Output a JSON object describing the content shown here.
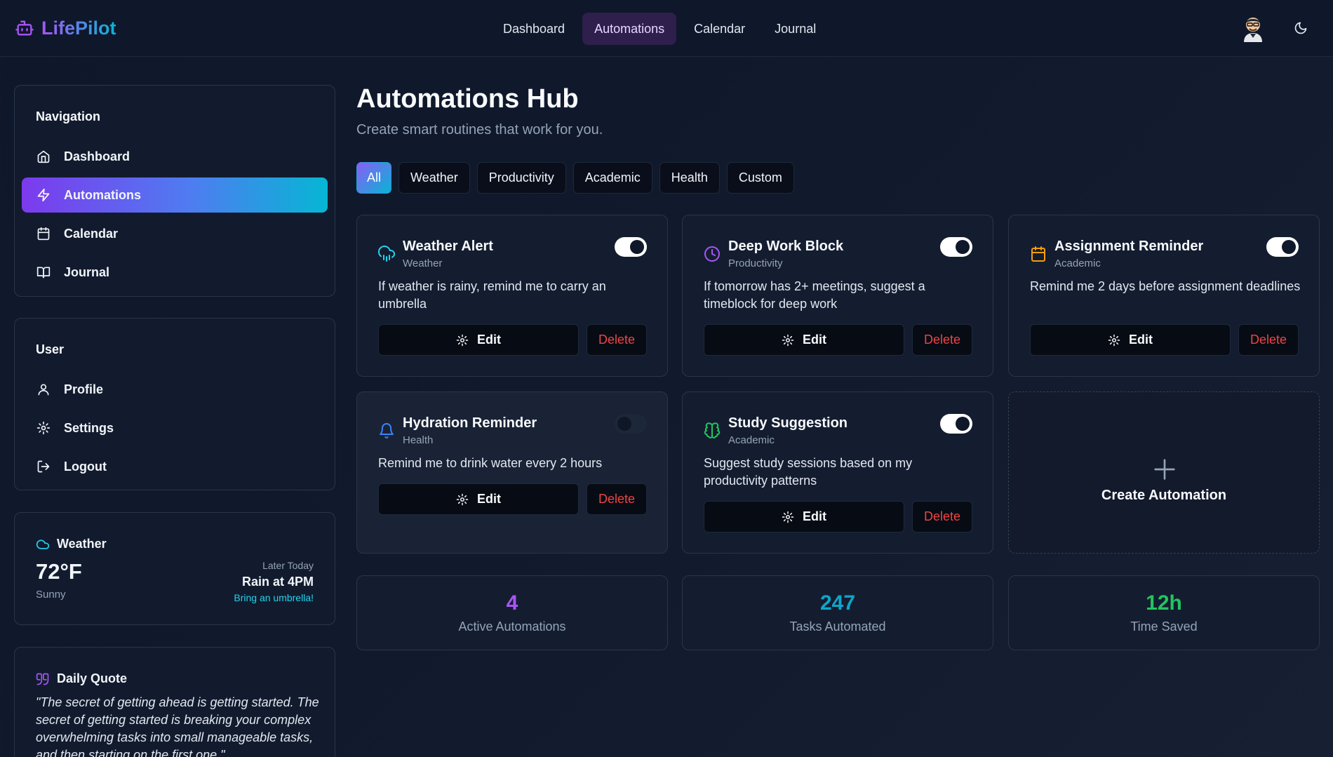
{
  "app": {
    "name": "LifePilot"
  },
  "topnav": [
    {
      "label": "Dashboard",
      "active": false
    },
    {
      "label": "Automations",
      "active": true
    },
    {
      "label": "Calendar",
      "active": false
    },
    {
      "label": "Journal",
      "active": false
    }
  ],
  "sidebar": {
    "navigation": {
      "title": "Navigation",
      "items": [
        {
          "label": "Dashboard",
          "icon": "home-icon"
        },
        {
          "label": "Automations",
          "icon": "lightning-icon",
          "active": true
        },
        {
          "label": "Calendar",
          "icon": "calendar-icon"
        },
        {
          "label": "Journal",
          "icon": "book-icon"
        }
      ]
    },
    "user": {
      "title": "User",
      "items": [
        {
          "label": "Profile",
          "icon": "user-icon"
        },
        {
          "label": "Settings",
          "icon": "gear-icon"
        },
        {
          "label": "Logout",
          "icon": "logout-icon"
        }
      ]
    },
    "weather": {
      "title": "Weather",
      "temp": "72°F",
      "condition": "Sunny",
      "later_label": "Later Today",
      "later_forecast": "Rain at 4PM",
      "tip": "Bring an umbrella!"
    },
    "quote": {
      "title": "Daily Quote",
      "text": "\"The secret of getting ahead is getting started. The secret of getting started is breaking your complex overwhelming tasks into small manageable tasks, and then starting on the first one.\""
    }
  },
  "main": {
    "title": "Automations Hub",
    "subtitle": "Create smart routines that work for you.",
    "filters": [
      "All",
      "Weather",
      "Productivity",
      "Academic",
      "Health",
      "Custom"
    ],
    "active_filter": "All",
    "edit_label": "Edit",
    "delete_label": "Delete",
    "cards": [
      {
        "title": "Weather Alert",
        "category": "Weather",
        "description": "If weather is rainy, remind me to carry an umbrella",
        "enabled": true,
        "icon": "cloud-rain-icon",
        "icon_color": "#22d3ee"
      },
      {
        "title": "Deep Work Block",
        "category": "Productivity",
        "description": "If tomorrow has 2+ meetings, suggest a timeblock for deep work",
        "enabled": true,
        "icon": "clock-icon",
        "icon_color": "#a855f7"
      },
      {
        "title": "Assignment Reminder",
        "category": "Academic",
        "description": "Remind me 2 days before assignment deadlines",
        "enabled": true,
        "icon": "calendar-icon",
        "icon_color": "#f59e0b"
      },
      {
        "title": "Hydration Reminder",
        "category": "Health",
        "description": "Remind me to drink water every 2 hours",
        "enabled": false,
        "icon": "bell-icon",
        "icon_color": "#3b82f6"
      },
      {
        "title": "Study Suggestion",
        "category": "Academic",
        "description": "Suggest study sessions based on my productivity patterns",
        "enabled": true,
        "icon": "brain-icon",
        "icon_color": "#22c55e"
      }
    ],
    "create_label": "Create Automation",
    "stats": [
      {
        "value": "4",
        "label": "Active Automations",
        "color": "#a855f7"
      },
      {
        "value": "247",
        "label": "Tasks Automated",
        "color": "#06b6d4"
      },
      {
        "value": "12h",
        "label": "Time Saved",
        "color": "#22c55e"
      }
    ]
  }
}
